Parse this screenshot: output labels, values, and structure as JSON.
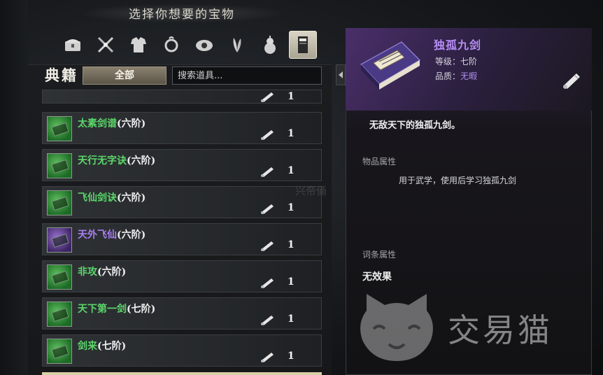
{
  "header": {
    "title": "选择你想要的宝物"
  },
  "tabs": [
    {
      "name": "chest-icon"
    },
    {
      "name": "weapons-icon"
    },
    {
      "name": "armor-icon"
    },
    {
      "name": "accessory-icon"
    },
    {
      "name": "eye-icon"
    },
    {
      "name": "herb-icon"
    },
    {
      "name": "gourd-icon"
    },
    {
      "name": "book-icon",
      "active": true
    }
  ],
  "left": {
    "category": "典籍",
    "filter_label": "全部",
    "search_placeholder": "搜索道具..."
  },
  "items": [
    {
      "name": "太素剑谱",
      "tier": "(六阶)",
      "qty": "1",
      "color": "green"
    },
    {
      "name": "天行无字诀",
      "tier": "(六阶)",
      "qty": "1",
      "color": "green"
    },
    {
      "name": "飞仙剑诀",
      "tier": "(六阶)",
      "qty": "1",
      "color": "green"
    },
    {
      "name": "天外飞仙",
      "tier": "(六阶)",
      "qty": "1",
      "color": "purple"
    },
    {
      "name": "非攻",
      "tier": "(六阶)",
      "qty": "1",
      "color": "green"
    },
    {
      "name": "天下第一剑",
      "tier": "(七阶)",
      "qty": "1",
      "color": "green"
    },
    {
      "name": "剑来",
      "tier": "(七阶)",
      "qty": "1",
      "color": "green"
    }
  ],
  "top_partial_qty": "1",
  "detail": {
    "name": "独孤九剑",
    "level_label": "等级：",
    "level_value": "七阶",
    "quality_label": "品质：",
    "quality_value": "无暇",
    "description": "无敌天下的独孤九剑。",
    "item_props_title": "物品属性",
    "item_props_text": "用于武学，使用后学习独孤九剑",
    "entry_props_title": "词条属性",
    "entry_props_text": "无效果"
  },
  "watermark": {
    "faint": "兴帝俑",
    "brand": "交易猫"
  },
  "colors": {
    "green_item": "#5bd66a",
    "purple_item": "#a97ef2",
    "accent_purple": "#b68ef5"
  }
}
